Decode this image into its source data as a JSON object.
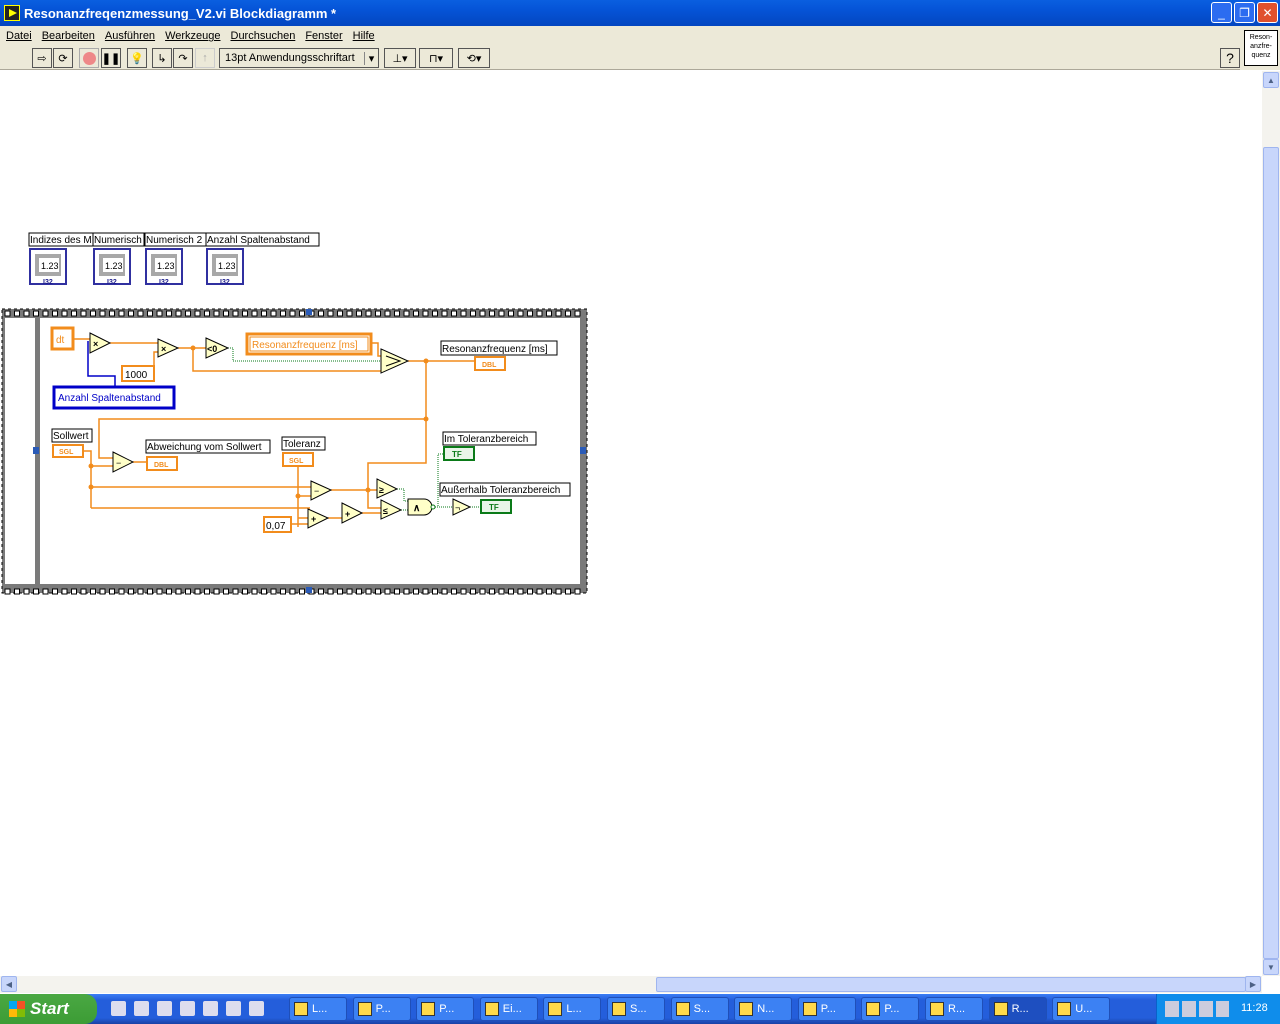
{
  "window": {
    "title": "Resonanzfreqenzmessung_V2.vi Blockdiagramm *",
    "min": "_",
    "max": "❐",
    "close": "✕"
  },
  "menu": [
    "Datei",
    "Bearbeiten",
    "Ausführen",
    "Werkzeuge",
    "Durchsuchen",
    "Fenster",
    "Hilfe"
  ],
  "toolbar": {
    "font": "13pt Anwendungsschriftart",
    "help": "?",
    "vi_icon_text": "Reson-anzfre-quenz"
  },
  "controls": [
    {
      "label": "Indizes des M",
      "value": "1.23",
      "type": "I32"
    },
    {
      "label": "Numerisch",
      "value": "1.23",
      "type": "I32"
    },
    {
      "label": "Numerisch 2",
      "value": "1.23",
      "type": "I32"
    },
    {
      "label": "Anzahl Spaltenabstand",
      "value": "1.23",
      "type": "I32"
    }
  ],
  "diagram": {
    "dt": "dt",
    "const1000": "1000",
    "anzahl": "Anzahl Spaltenabstand",
    "mult": "×",
    "lt0": "<0",
    "local_res": "Resonanzfrequenz [ms]",
    "res_label": "Resonanzfrequenz [ms]",
    "dbl": "DBL",
    "sgl": "SGL",
    "tf": "TF",
    "sollwert": "Sollwert",
    "abweichung": "Abweichung vom Sollwert",
    "toleranz": "Toleranz",
    "const007": "0,07",
    "minus": "−",
    "plus": "+",
    "ge": "≥",
    "le": "≤",
    "and": "∧",
    "not": "¬",
    "im_tol": "Im Toleranzbereich",
    "ausser_tol": "Außerhalb Toleranzbereich"
  },
  "taskbar": {
    "start": "Start",
    "tasks": [
      "L...",
      "P...",
      "P...",
      "Ei...",
      "L...",
      "S...",
      "S...",
      "N...",
      "P...",
      "P...",
      "R...",
      "R...",
      "U..."
    ],
    "clock": "11:28"
  },
  "colors": {
    "wire_orange": "#f28c1c",
    "wire_blue": "#0000c8",
    "bool_green": "#0a7a18",
    "title_blue": "#0553d6"
  }
}
